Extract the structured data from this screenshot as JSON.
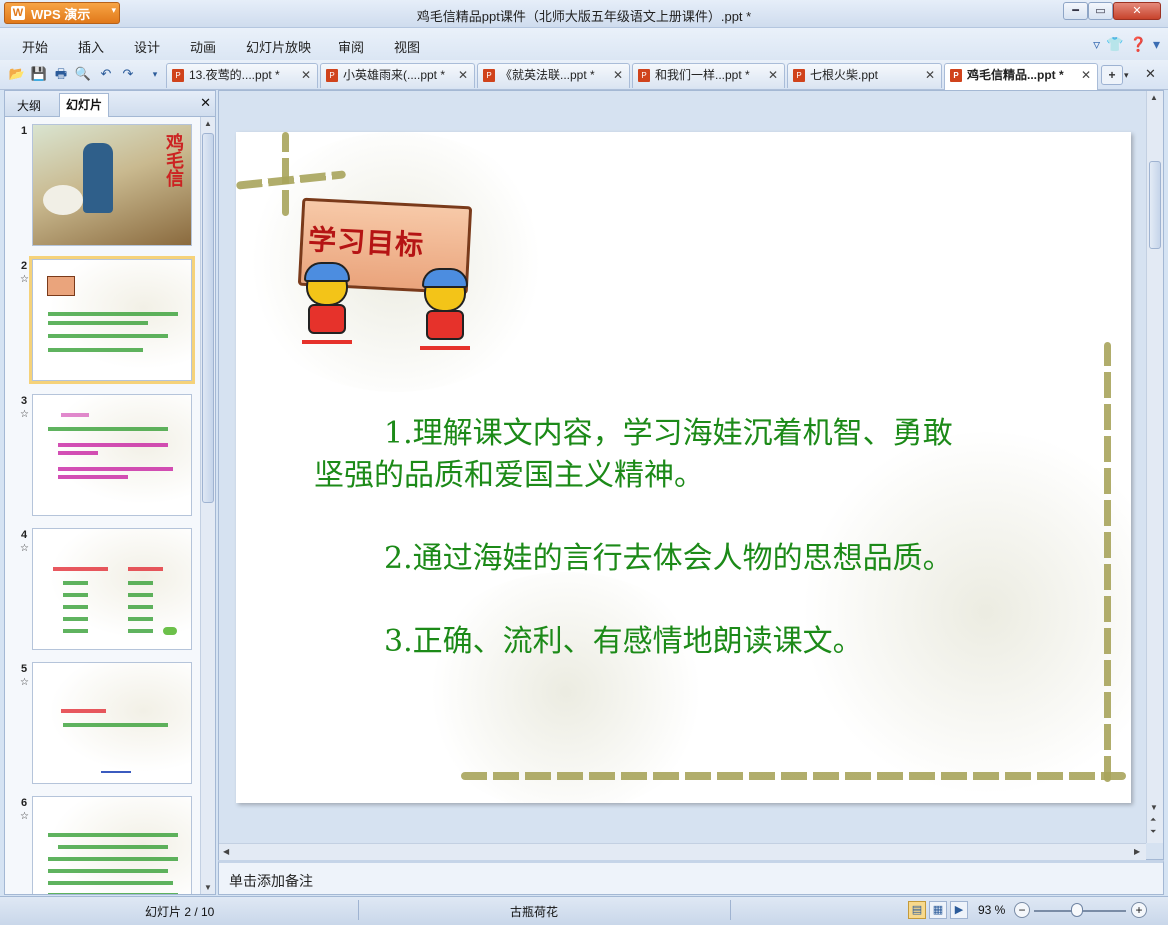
{
  "window": {
    "app_button": "WPS 演示",
    "title": "鸡毛信精品ppt课件（北师大版五年级语文上册课件）.ppt *"
  },
  "menu": [
    "开始",
    "插入",
    "设计",
    "动画",
    "幻灯片放映",
    "审阅",
    "视图"
  ],
  "tabs": [
    {
      "label": "13.夜莺的....ppt *"
    },
    {
      "label": "小英雄雨来(....ppt *"
    },
    {
      "label": "《就英法联...ppt *"
    },
    {
      "label": "和我们一样...ppt *"
    },
    {
      "label": "七根火柴.ppt"
    },
    {
      "label": "鸡毛信精品...ppt *"
    }
  ],
  "left_panel": {
    "tab_outline": "大纲",
    "tab_slides": "幻灯片",
    "thumb_numbers": [
      "1",
      "2",
      "3",
      "4",
      "5",
      "6"
    ]
  },
  "slide": {
    "heading": "学习目标",
    "goals": [
      "1.理解课文内容，学习海娃沉着机智、勇敢",
      "坚强的品质和爱国主义精神。",
      "2.通过海娃的言行去体会人物的思想品质。",
      "3.正确、流利、有感情地朗读课文。"
    ]
  },
  "notes_placeholder": "单击添加备注",
  "status": {
    "slide_counter": "幻灯片 2 / 10",
    "theme": "古瓶荷花",
    "zoom": "93 %"
  },
  "colors": {
    "goal_text": "#1c8a18",
    "heading_text": "#b51414",
    "wps_orange": "#e1791a"
  }
}
